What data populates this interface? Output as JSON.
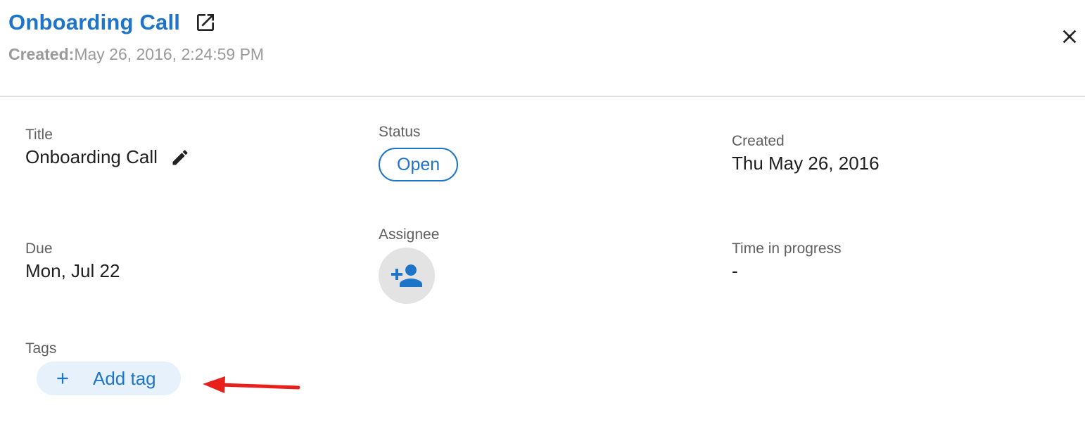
{
  "header": {
    "title": "Onboarding Call",
    "created_label": "Created:",
    "created_value": "May 26, 2016, 2:24:59 PM"
  },
  "fields": {
    "title": {
      "label": "Title",
      "value": "Onboarding Call"
    },
    "status": {
      "label": "Status",
      "value": "Open"
    },
    "created": {
      "label": "Created",
      "value": "Thu May 26, 2016"
    },
    "due": {
      "label": "Due",
      "value": "Mon, Jul 22"
    },
    "assignee": {
      "label": "Assignee"
    },
    "time_in_progress": {
      "label": "Time in progress",
      "value": "-"
    },
    "tags": {
      "label": "Tags",
      "add_label": "Add tag"
    }
  },
  "icons": {
    "open_external": "open-in-new-icon",
    "close": "close-icon",
    "edit": "pencil-icon",
    "assignee": "add-person-icon",
    "add_tag": "plus-icon",
    "annotation": "red-arrow"
  },
  "colors": {
    "accent": "#1e74c9",
    "annotation": "#e8201c",
    "avatar_bg": "#e3e3e3",
    "tag_bg": "#e6f1fb"
  }
}
